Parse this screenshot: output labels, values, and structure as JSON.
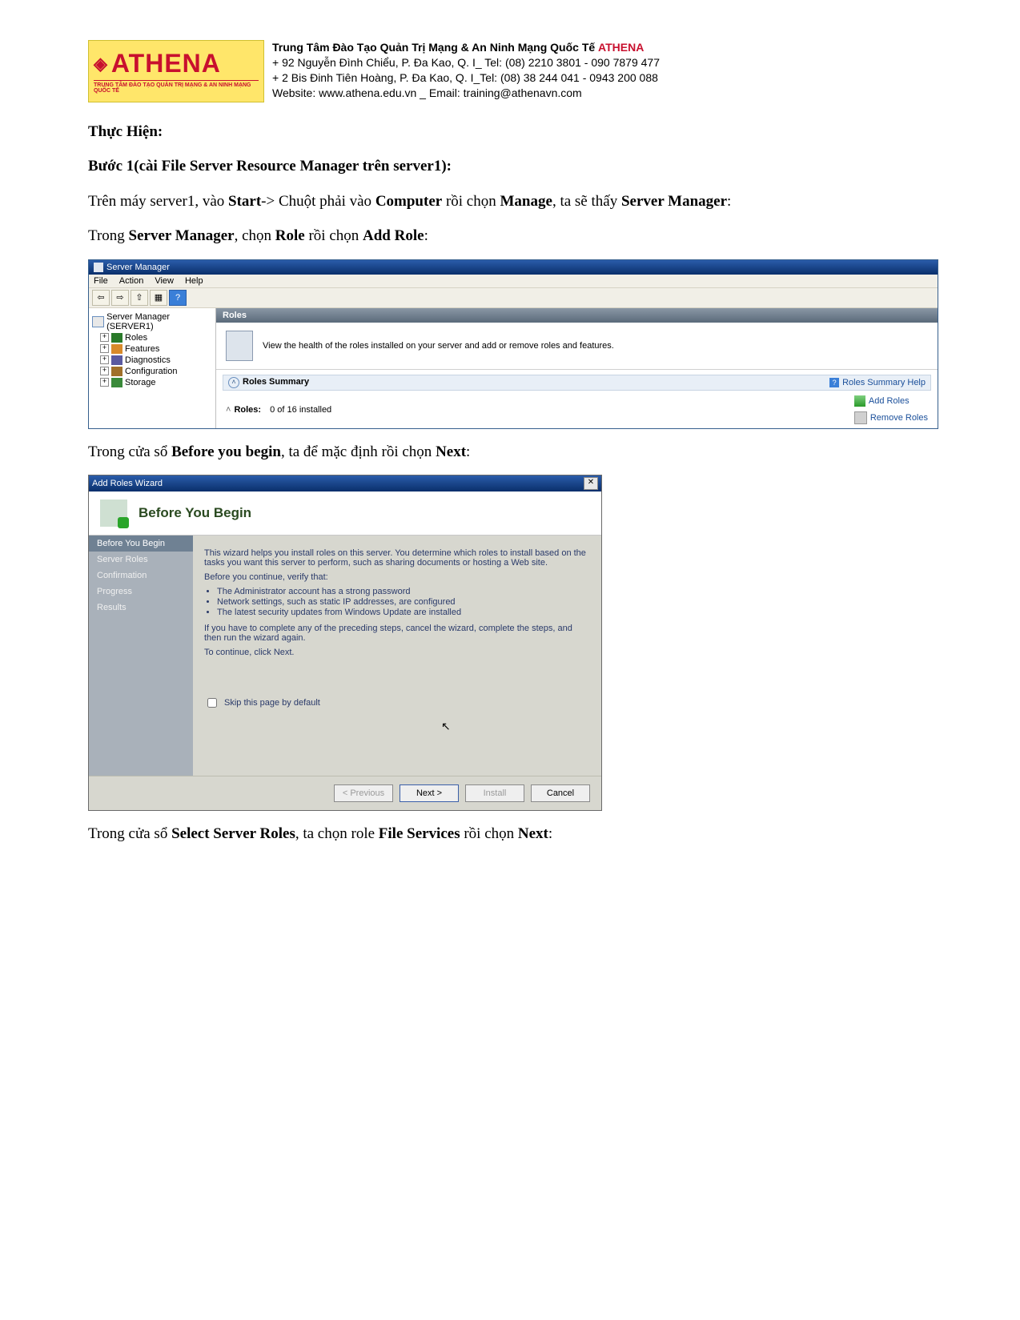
{
  "banner": {
    "brand": "ATHENA",
    "tagline": "TRUNG TÂM ĐÀO TẠO QUẢN TRỊ MẠNG & AN NINH MẠNG QUỐC TẾ",
    "line1_prefix": "Trung Tâm Đào Tạo Quản Trị Mạng & An Ninh Mạng Quốc Tế ",
    "line1_brand": "ATHENA",
    "line2": "+  92 Nguyễn Đình Chiểu, P. Đa Kao, Q. I_ Tel: (08) 2210 3801 -  090 7879 477",
    "line3": "+  2 Bis Đinh Tiên Hoàng, P. Đa Kao, Q. I_Tel: (08) 38 244 041 - 0943 200 088",
    "line4": "Website:  www.athena.edu.vn     _       Email: training@athenavn.com"
  },
  "doc": {
    "thuc_hien": "Thực Hiện:",
    "buoc1": "Bước 1(cài File Server Resource Manager trên server1):",
    "p1_a": "Trên máy server1, vào ",
    "p1_b": "Start",
    "p1_c": "-> Chuột phải vào ",
    "p1_d": "Computer",
    "p1_e": " rồi chọn ",
    "p1_f": "Manage",
    "p1_g": ", ta sẽ thấy ",
    "p1_h": "Server Manager",
    "p1_i": ":",
    "p2_a": "Trong ",
    "p2_b": "Server Manager",
    "p2_c": ", chọn ",
    "p2_d": "Role",
    "p2_e": " rồi chọn ",
    "p2_f": "Add Role",
    "p2_g": ":",
    "p3_a": "Trong cửa sổ ",
    "p3_b": "Before you begin",
    "p3_c": ", ta để mặc định rồi chọn ",
    "p3_d": "Next",
    "p3_e": ":",
    "p4_a": "Trong cửa sổ ",
    "p4_b": "Select Server Roles",
    "p4_c": ", ta chọn role ",
    "p4_d": "File Services",
    "p4_e": " rồi chọn ",
    "p4_f": "Next",
    "p4_g": ":"
  },
  "sm": {
    "title": "Server Manager",
    "menu": {
      "file": "File",
      "action": "Action",
      "view": "View",
      "help": "Help"
    },
    "toolbar_icons": {
      "back": "⇦",
      "fwd": "⇨",
      "up": "⇧",
      "props": "▦",
      "help": "?"
    },
    "tree": {
      "root": "Server Manager (SERVER1)",
      "roles": "Roles",
      "features": "Features",
      "diagnostics": "Diagnostics",
      "configuration": "Configuration",
      "storage": "Storage"
    },
    "main_header": "Roles",
    "main_desc": "View the health of the roles installed on your server and add or remove roles and features.",
    "summary_label": "Roles Summary",
    "summary_help": "Roles Summary Help",
    "roles_count_label": "Roles:",
    "roles_count_value": "0 of 16 installed",
    "add_roles": "Add Roles",
    "remove_roles": "Remove Roles"
  },
  "wiz": {
    "title": "Add Roles Wizard",
    "header": "Before You Begin",
    "nav": {
      "byb": "Before You Begin",
      "sr": "Server Roles",
      "conf": "Confirmation",
      "prog": "Progress",
      "res": "Results"
    },
    "body": {
      "intro": "This wizard helps you install roles on this server. You determine which roles to install based on the tasks you want this server to perform, such as sharing documents or hosting a Web site.",
      "verify": "Before you continue, verify that:",
      "b1": "The Administrator account has a strong password",
      "b2": "Network settings, such as static IP addresses, are configured",
      "b3": "The latest security updates from Windows Update are installed",
      "complete": "If you have to complete any of the preceding steps, cancel the wizard, complete the steps, and then run the wizard again.",
      "cont": "To continue, click Next.",
      "skip": "Skip this page by default"
    },
    "buttons": {
      "prev": "< Previous",
      "next": "Next >",
      "install": "Install",
      "cancel": "Cancel"
    }
  }
}
